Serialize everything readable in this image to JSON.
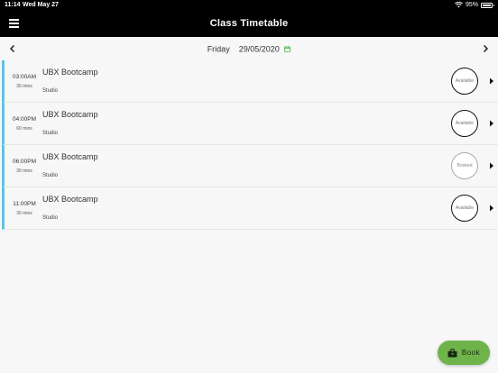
{
  "status_bar": {
    "time": "11:14",
    "date": "Wed May 27",
    "battery": "95%",
    "icons": [
      "wifi-icon",
      "battery-icon"
    ]
  },
  "app_bar": {
    "title": "Class Timetable",
    "menu_icon": "hamburger-menu-icon"
  },
  "date_nav": {
    "day": "Friday",
    "date": "29/05/2020",
    "icons": [
      "chevron-left-icon",
      "calendar-icon",
      "chevron-right-icon"
    ],
    "calendar_icon_color": "#4caf50"
  },
  "classes": [
    {
      "time": "03:00AM",
      "duration": "30 mins",
      "name": "UBX Bootcamp",
      "location": "Studio",
      "status": "Available"
    },
    {
      "time": "04:00PM",
      "duration": "60 mins",
      "name": "UBX Bootcamp",
      "location": "Studio",
      "status": "Available"
    },
    {
      "time": "06:00PM",
      "duration": "30 mins",
      "name": "UBX Bootcamp",
      "location": "Studio",
      "status": "Booked"
    },
    {
      "time": "11:00PM",
      "duration": "30 mins",
      "name": "UBX Bootcamp",
      "location": "Studio",
      "status": "Available"
    }
  ],
  "book_button": {
    "label": "Book",
    "icon": "briefcase-icon",
    "color": "#6fb34b"
  },
  "colors": {
    "accent_bar": "#5bc4e0",
    "header_bg": "#000000"
  }
}
